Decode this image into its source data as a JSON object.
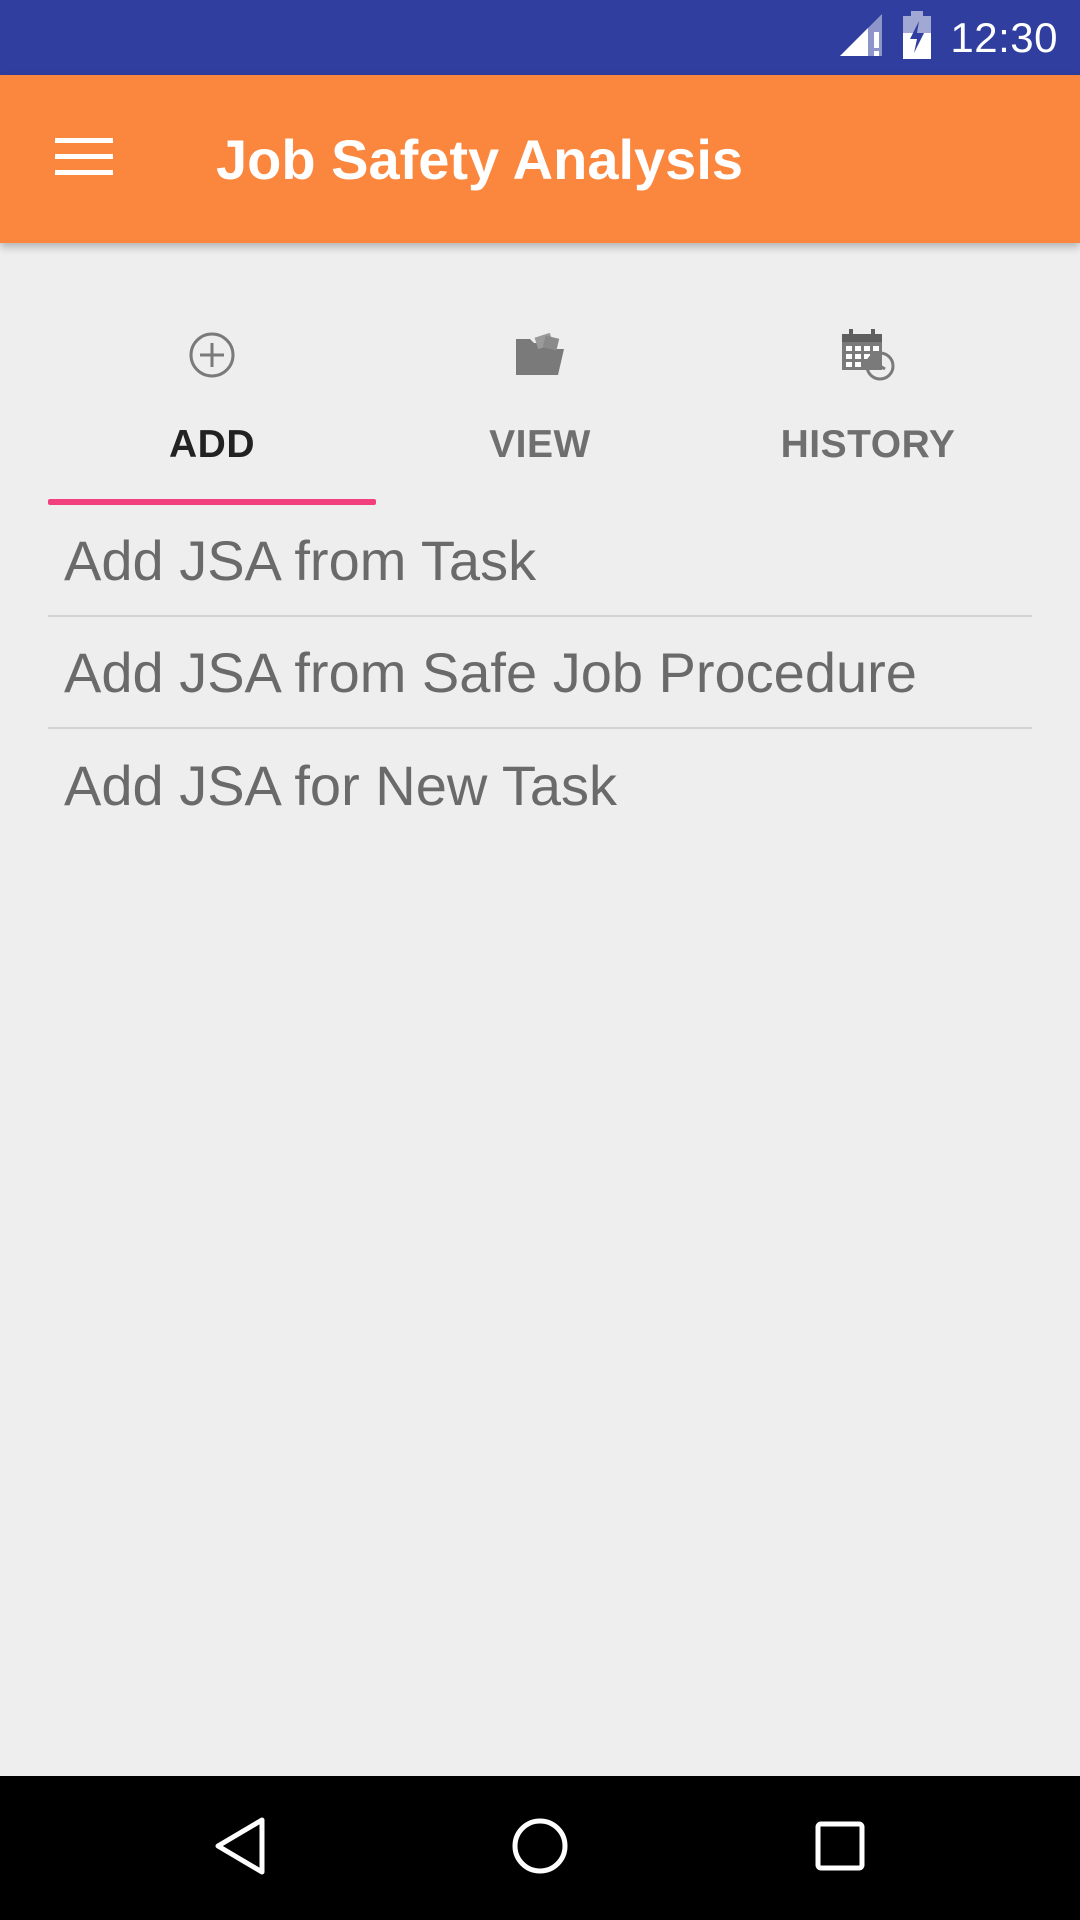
{
  "status_bar": {
    "time": "12:30",
    "icons": [
      "signal-icon",
      "battery-charging-icon"
    ]
  },
  "app_bar": {
    "title": "Job Safety Analysis",
    "menu_icon": "hamburger-menu-icon"
  },
  "tabs": [
    {
      "label": "ADD",
      "icon": "add-circle-icon",
      "active": true
    },
    {
      "label": "VIEW",
      "icon": "folder-open-icon",
      "active": false
    },
    {
      "label": "HISTORY",
      "icon": "calendar-history-icon",
      "active": false
    }
  ],
  "list": {
    "items": [
      {
        "label": "Add JSA from Task"
      },
      {
        "label": "Add JSA from Safe Job Procedure"
      },
      {
        "label": "Add JSA for New Task"
      }
    ]
  },
  "nav_bar": {
    "icons": [
      "back-icon",
      "home-icon",
      "recents-icon"
    ]
  },
  "colors": {
    "status_bar": "#303f9f",
    "app_bar": "#fb873e",
    "tab_indicator": "#f2407e",
    "background": "#eeeeee"
  }
}
